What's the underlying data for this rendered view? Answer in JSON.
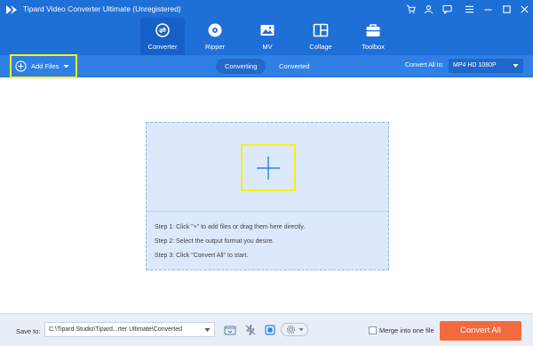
{
  "app": {
    "title": "Tipard Video Converter Ultimate (Unregistered)"
  },
  "window_controls": [
    {
      "name": "cart-icon"
    },
    {
      "name": "user-icon"
    },
    {
      "name": "chat-icon"
    },
    {
      "name": "menu-icon"
    },
    {
      "name": "minimize-icon"
    },
    {
      "name": "maximize-icon"
    },
    {
      "name": "close-icon"
    }
  ],
  "nav": {
    "active": "Converter",
    "tabs": [
      {
        "label": "Converter",
        "icon": "converter-icon"
      },
      {
        "label": "Ripper",
        "icon": "ripper-icon"
      },
      {
        "label": "MV",
        "icon": "mv-icon"
      },
      {
        "label": "Collage",
        "icon": "collage-icon"
      },
      {
        "label": "Toolbox",
        "icon": "toolbox-icon"
      }
    ]
  },
  "toolbar": {
    "add_files_label": "Add Files",
    "tabs": [
      {
        "label": "Converting",
        "active": true
      },
      {
        "label": "Converted",
        "active": false
      }
    ],
    "convert_all_to_label": "Convert All to:",
    "format_value": "MP4 HD 1080P"
  },
  "dropzone": {
    "steps": [
      "Step 1: Click \"+\" to add files or drag them here directly.",
      "Step 2: Select the output format you desire.",
      "Step 3: Click \"Convert All\" to start."
    ]
  },
  "bottom": {
    "save_to_label": "Save to:",
    "save_path": "C:\\Tipard Studio\\Tipard...rter Ultimate\\Converted",
    "merge_label": "Merge into one file",
    "merge_checked": false,
    "convert_all_label": "Convert All"
  },
  "colors": {
    "header_bg": "#1e6fd6",
    "subbar_bg": "#2f7fe4",
    "highlight": "#f5ef1a",
    "dropzone_bg": "#dbe9fa",
    "convert_button": "#f26a3d"
  }
}
